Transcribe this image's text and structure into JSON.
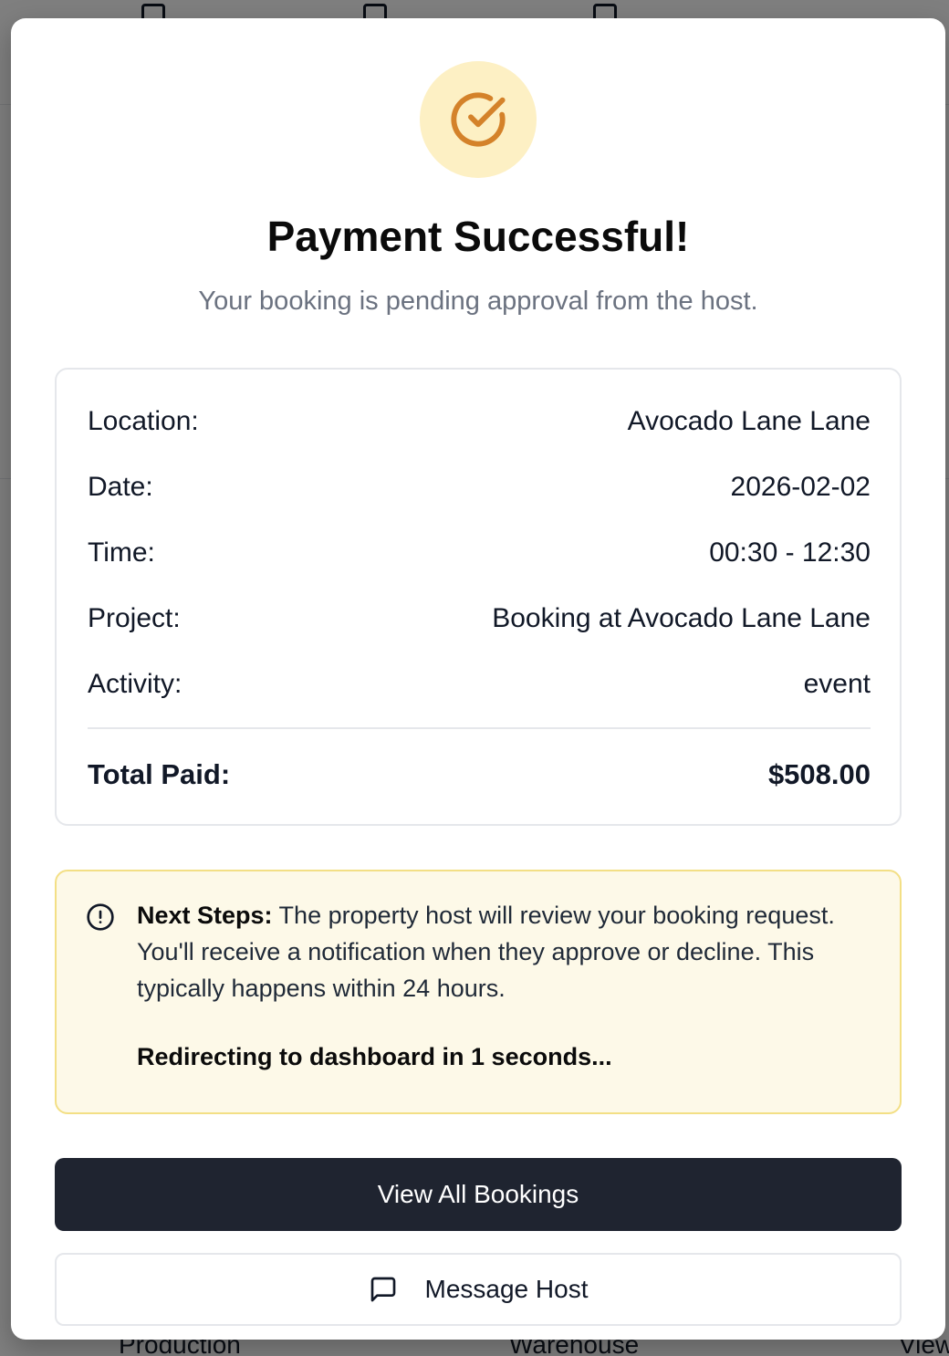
{
  "background": {
    "footer": [
      "Production",
      "Warehouse",
      "View"
    ]
  },
  "modal": {
    "title": "Payment Successful!",
    "subtitle": "Your booking is pending approval from the host.",
    "success_icon": "check-circle-icon",
    "accent_color": "#d4822a",
    "details": {
      "rows": [
        {
          "label": "Location:",
          "value": "Avocado Lane Lane"
        },
        {
          "label": "Date:",
          "value": "2026-02-02"
        },
        {
          "label": "Time:",
          "value": "00:30 - 12:30"
        },
        {
          "label": "Project:",
          "value": "Booking at Avocado Lane Lane"
        },
        {
          "label": "Activity:",
          "value": "event"
        }
      ],
      "total_label": "Total Paid:",
      "total_value": "$508.00"
    },
    "notice": {
      "icon": "info-circle-icon",
      "heading": "Next Steps:",
      "body": " The property host will review your booking request. You'll receive a notification when they approve or decline. This typically happens within 24 hours.",
      "redirect": "Redirecting to dashboard in 1 seconds..."
    },
    "buttons": {
      "primary": "View All Bookings",
      "secondary": "Message Host",
      "secondary_icon": "message-square-icon"
    }
  }
}
